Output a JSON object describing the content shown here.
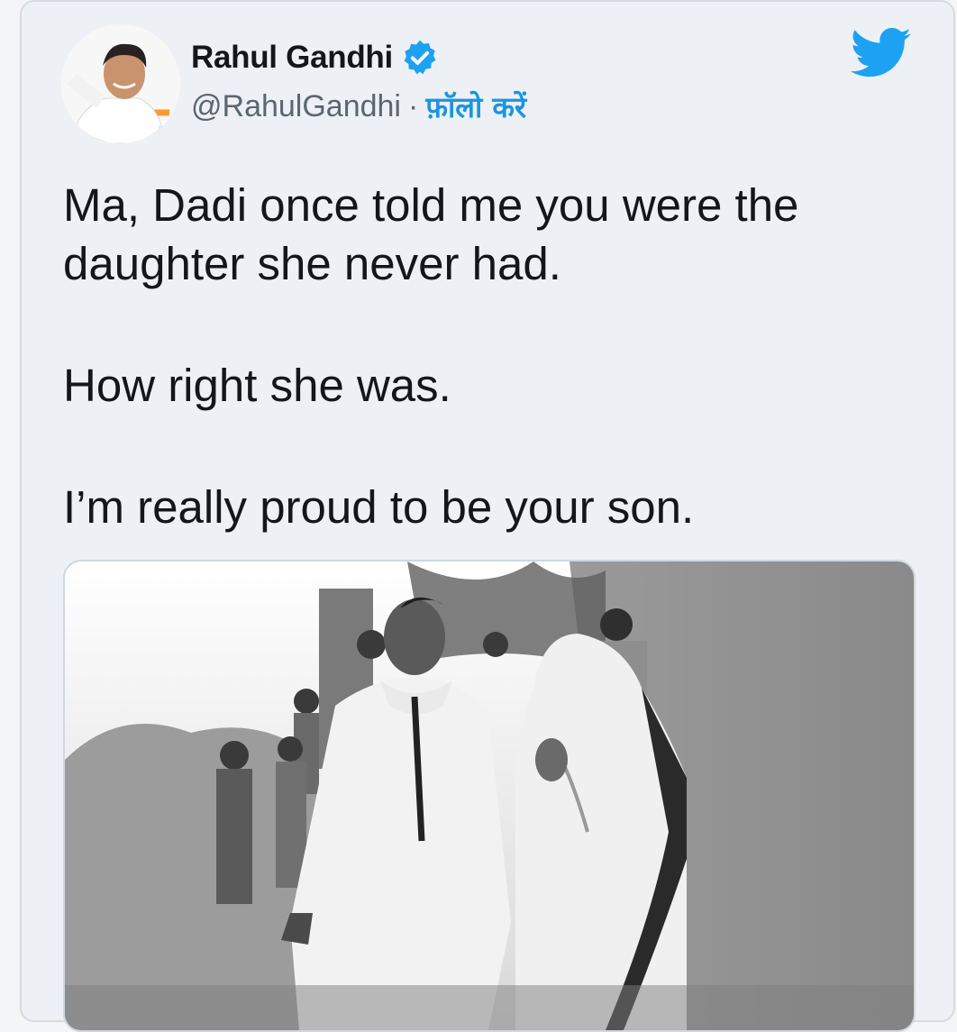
{
  "tweet": {
    "author": {
      "display_name": "Rahul Gandhi",
      "handle": "@RahulGandhi",
      "separator": "·",
      "follow_label": "फ़ॉलो करें",
      "verified": true
    },
    "text": {
      "line1": "Ma, Dadi once told me you were the daughter she never had.",
      "line2": "How right she was.",
      "line3": "I’m really proud to be your son."
    },
    "media": {
      "type": "photo",
      "style": "black-and-white"
    }
  },
  "colors": {
    "twitter_blue": "#1da1f2",
    "link_blue": "#1b95e0",
    "card_bg": "#edf1f5",
    "text": "#14171a",
    "secondary_text": "#5b6670"
  },
  "icons": {
    "brand": "twitter-bird-icon",
    "verified": "verified-badge-icon"
  }
}
